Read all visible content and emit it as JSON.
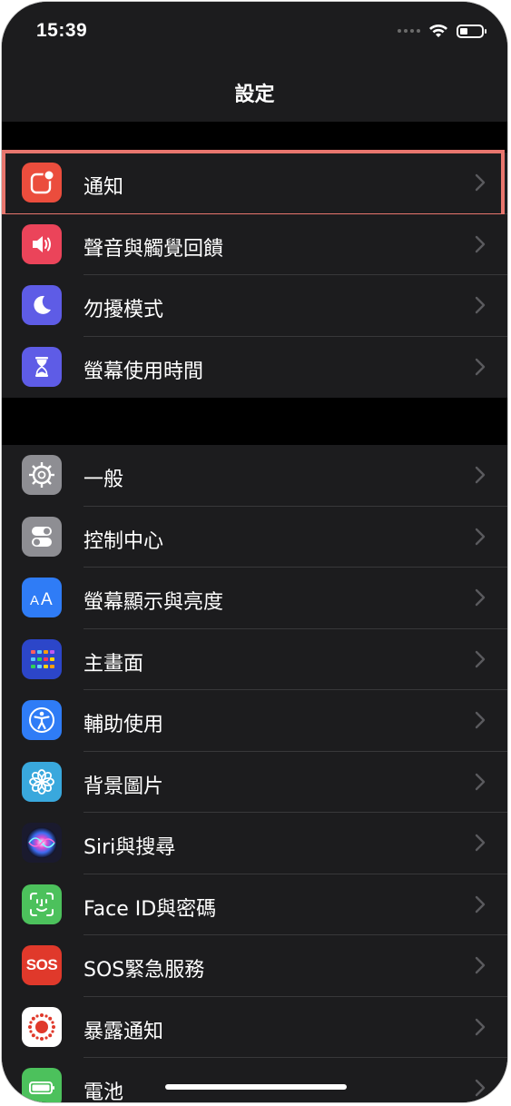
{
  "status_bar": {
    "time": "15:39",
    "battery_level": 0.35
  },
  "nav": {
    "title": "設定"
  },
  "groups": [
    [
      {
        "key": "notifications",
        "label": "通知",
        "icon": "notification-icon",
        "icon_bg": "#eb4d3d",
        "highlighted": true
      },
      {
        "key": "sounds",
        "label": "聲音與觸覺回饋",
        "icon": "speaker-icon",
        "icon_bg": "#eb445a"
      },
      {
        "key": "do-not-disturb",
        "label": "勿擾模式",
        "icon": "moon-icon",
        "icon_bg": "#5e5ce6"
      },
      {
        "key": "screen-time",
        "label": "螢幕使用時間",
        "icon": "hourglass-icon",
        "icon_bg": "#5e5ce6"
      }
    ],
    [
      {
        "key": "general",
        "label": "一般",
        "icon": "gear-icon",
        "icon_bg": "#8e8e93"
      },
      {
        "key": "control-center",
        "label": "控制中心",
        "icon": "toggles-icon",
        "icon_bg": "#8e8e93"
      },
      {
        "key": "display",
        "label": "螢幕顯示與亮度",
        "icon": "text-size-icon",
        "icon_bg": "#2f7cf6"
      },
      {
        "key": "home-screen",
        "label": "主畫面",
        "icon": "app-grid-icon",
        "icon_bg": "#2c46c9"
      },
      {
        "key": "accessibility",
        "label": "輔助使用",
        "icon": "accessibility-icon",
        "icon_bg": "#2f7cf6"
      },
      {
        "key": "wallpaper",
        "label": "背景圖片",
        "icon": "flower-icon",
        "icon_bg": "#39a8dd"
      },
      {
        "key": "siri",
        "label": "Siri與搜尋",
        "icon": "siri-icon",
        "icon_bg": "#1a1a2e"
      },
      {
        "key": "face-id",
        "label": "Face ID與密碼",
        "icon": "face-id-icon",
        "icon_bg": "#4cc15c"
      },
      {
        "key": "sos",
        "label": "SOS緊急服務",
        "icon": "sos-icon",
        "icon_bg": "#e0392b",
        "icon_text": "SOS"
      },
      {
        "key": "exposure",
        "label": "暴露通知",
        "icon": "exposure-icon",
        "icon_bg": "#ffffff"
      },
      {
        "key": "battery",
        "label": "電池",
        "icon": "battery-icon",
        "icon_bg": "#4cc15c"
      }
    ]
  ]
}
